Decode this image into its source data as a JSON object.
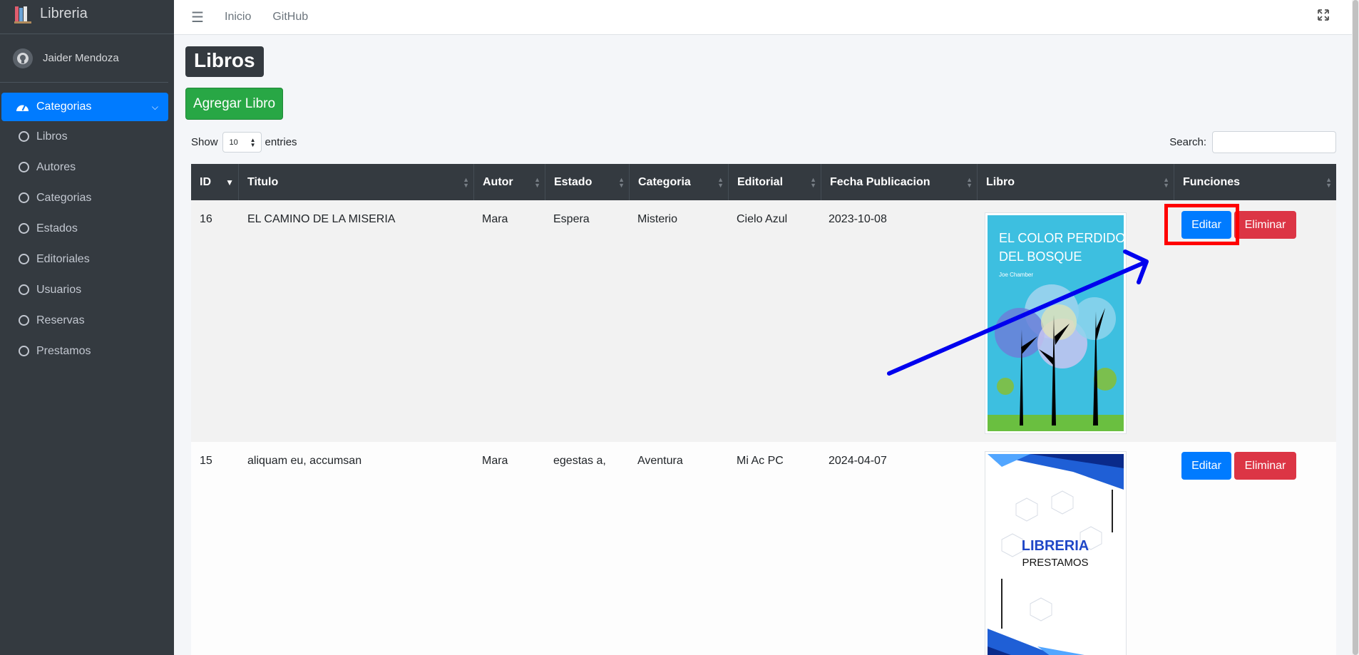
{
  "app": {
    "brand": "Libreria",
    "user": "Jaider Mendoza"
  },
  "sidebar": {
    "active": "Categorias",
    "items": [
      "Libros",
      "Autores",
      "Categorias",
      "Estados",
      "Editoriales",
      "Usuarios",
      "Reservas",
      "Prestamos"
    ]
  },
  "topnav": {
    "links": [
      "Inicio",
      "GitHub"
    ]
  },
  "page": {
    "title": "Libros",
    "add_button": "Agregar Libro"
  },
  "table_controls": {
    "show_label": "Show",
    "entries_value": "10",
    "entries_label": "entries",
    "search_label": "Search:",
    "search_value": ""
  },
  "table": {
    "columns": [
      "ID",
      "Titulo",
      "Autor",
      "Estado",
      "Categoria",
      "Editorial",
      "Fecha Publicacion",
      "Libro",
      "Funciones"
    ],
    "rows": [
      {
        "id": "16",
        "titulo": "EL CAMINO DE LA MISERIA",
        "autor": "Mara",
        "estado": "Espera",
        "categoria": "Misterio",
        "editorial": "Cielo Azul",
        "fecha": "2023-10-08",
        "cover_title_1": "EL COLOR PERDIDO",
        "cover_title_2": "DEL BOSQUE",
        "cover_author": "Joe Chamber"
      },
      {
        "id": "15",
        "titulo": "aliquam eu, accumsan",
        "autor": "Mara",
        "estado": "egestas a,",
        "categoria": "Aventura",
        "editorial": "Mi Ac PC",
        "fecha": "2024-04-07",
        "cover_title_1": "LIBRERIA",
        "cover_title_2": "PRESTAMOS"
      }
    ],
    "edit_label": "Editar",
    "delete_label": "Eliminar"
  },
  "colors": {
    "primary": "#007bff",
    "success": "#28a745",
    "danger": "#dc3545",
    "sidebar": "#343a40",
    "annotation_box": "#ff0000",
    "annotation_arrow": "#0000ee"
  }
}
